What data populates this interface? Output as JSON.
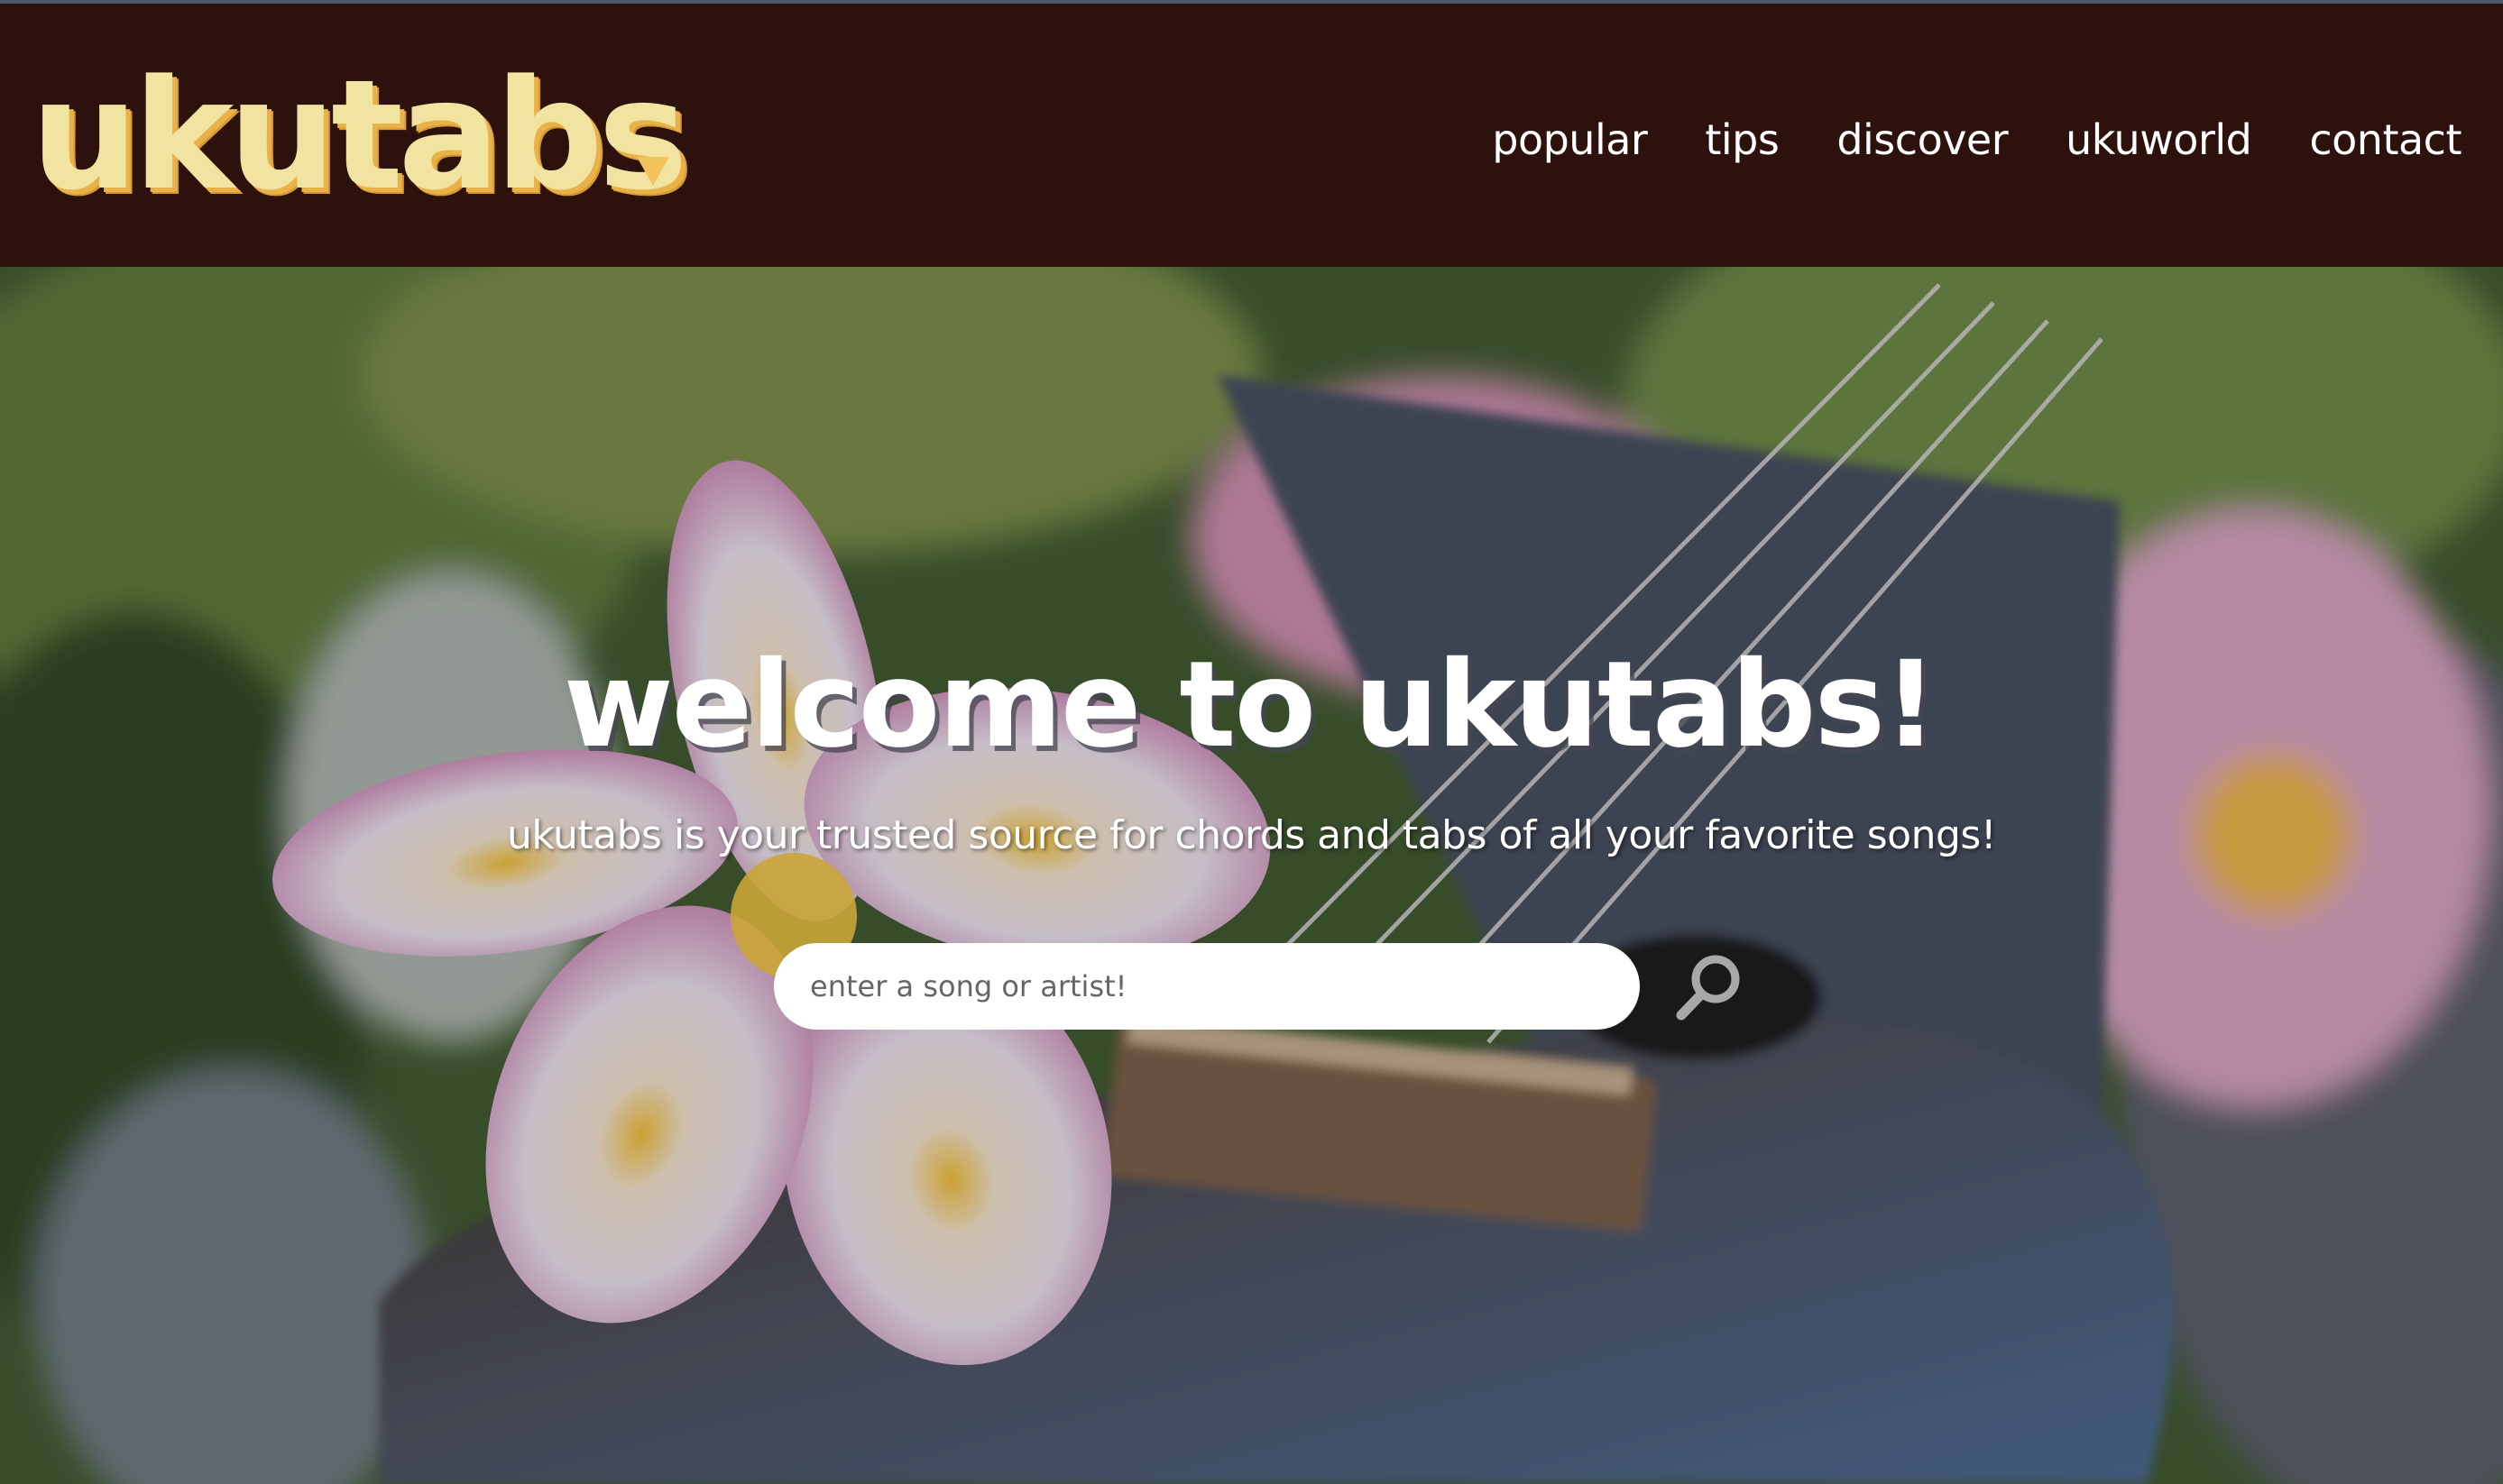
{
  "header": {
    "logo_text": "ukutabs",
    "nav": [
      {
        "label": "popular"
      },
      {
        "label": "tips"
      },
      {
        "label": "discover"
      },
      {
        "label": "ukuworld"
      },
      {
        "label": "contact"
      }
    ]
  },
  "hero": {
    "title": "welcome to ukutabs!",
    "tagline": "ukutabs is your trusted source for chords and tabs of all your favorite songs!",
    "search": {
      "placeholder": "enter a song or artist!",
      "value": ""
    }
  },
  "colors": {
    "header_bg": "#2d110c",
    "logo": "#f1e3a0",
    "logo_shadow": "#e9b248",
    "caret": "#f0c45a"
  },
  "icons": {
    "caret": "caret-down-icon",
    "search": "search-icon"
  }
}
